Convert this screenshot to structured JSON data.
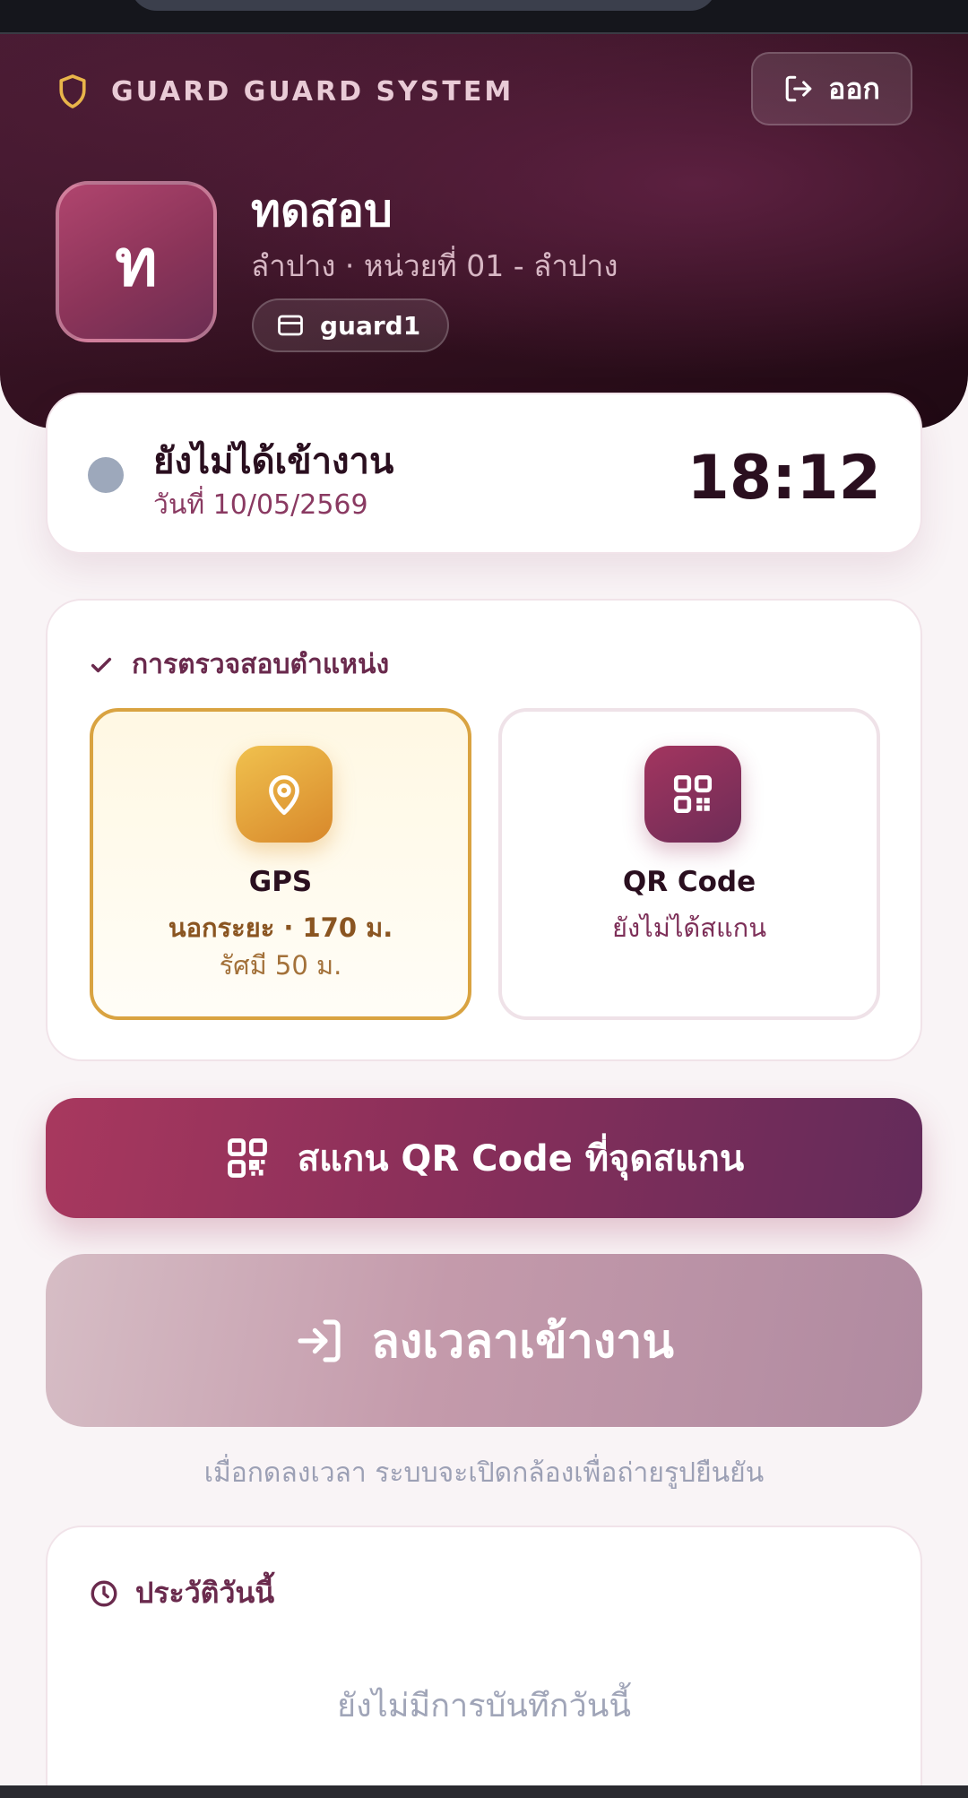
{
  "header": {
    "brand": "GUARD GUARD SYSTEM",
    "logout_label": "ออก",
    "avatar_initial": "ท",
    "name": "ทดสอบ",
    "unit": "ลำปาง · หน่วยที่ 01 - ลำปาง",
    "username": "guard1"
  },
  "status": {
    "text": "ยังไม่ได้เข้างาน",
    "date": "วันที่ 10/05/2569",
    "time": "18:12"
  },
  "verification": {
    "title": "การตรวจสอบตำแหน่ง",
    "gps": {
      "label": "GPS",
      "status": "นอกระยะ · 170 ม.",
      "radius": "รัศมี 50 ม."
    },
    "qr": {
      "label": "QR Code",
      "status": "ยังไม่ได้สแกน"
    }
  },
  "actions": {
    "scan_label": "สแกน QR Code ที่จุดสแกน",
    "checkin_label": "ลงเวลาเข้างาน",
    "hint": "เมื่อกดลงเวลา ระบบจะเปิดกล้องเพื่อถ่ายรูปยืนยัน"
  },
  "history": {
    "title": "ประวัติวันนี้",
    "empty": "ยังไม่มีการบันทึกวันนี้"
  },
  "colors": {
    "primary": "#8a2f5a",
    "accent": "#d9a341",
    "dark": "#2a0f1f"
  }
}
